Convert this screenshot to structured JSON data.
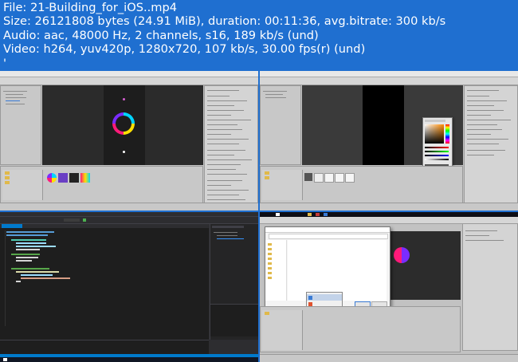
{
  "info": {
    "file": "File: 21-Building_for_iOS..mp4",
    "size": "Size: 26121808 bytes (24.91 MiB), duration: 00:11:36, avg.bitrate: 300 kb/s",
    "audio": "Audio: aac, 48000 Hz, 2 channels, s16, 189 kb/s (und)",
    "video": "Video: h264, yuv420p, 1280x720, 107 kb/s, 30.00 fps(r) (und)",
    "extra": "'"
  },
  "thumbnails": [
    {
      "id": "thumb-1",
      "app": "Unity Editor",
      "view": "game view with color ring and player settings inspector"
    },
    {
      "id": "thumb-2",
      "app": "Unity Editor",
      "view": "game view with color picker dialog"
    },
    {
      "id": "thumb-3",
      "app": "Visual Studio",
      "view": "code editor, dark theme"
    },
    {
      "id": "thumb-4",
      "app": "Unity Editor",
      "view": "file save dialog over scene"
    }
  ],
  "colors": {
    "background": "#1f6fd0",
    "text": "#ffffff",
    "unity_panel": "#c2c2c2",
    "vs_dark": "#1e1e1e",
    "taskbar": "#101624"
  }
}
